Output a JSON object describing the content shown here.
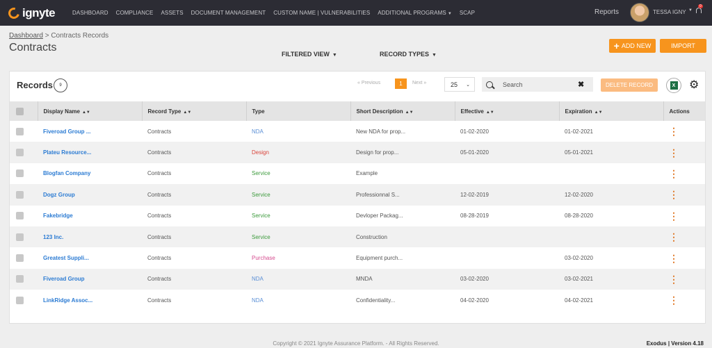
{
  "app": {
    "logo_text": "ignyte"
  },
  "nav": {
    "items": [
      {
        "label": "DASHBOARD",
        "caret": false
      },
      {
        "label": "COMPLIANCE",
        "caret": false
      },
      {
        "label": "ASSETS",
        "caret": false
      },
      {
        "label": "DOCUMENT MANAGEMENT",
        "caret": false
      },
      {
        "label": "CUSTOM NAME | VULNERABILITIES",
        "caret": false
      },
      {
        "label": "ADDITIONAL PROGRAMS",
        "caret": true
      },
      {
        "label": "SCAP",
        "caret": false
      }
    ],
    "reports": "Reports",
    "user_name": "TESSA IGNY",
    "notification_count": "0"
  },
  "header": {
    "breadcrumb": {
      "home": "Dashboard",
      "separator": ">",
      "current": "Contracts Records"
    },
    "title": "Contracts",
    "filtered_view": "FILTERED VIEW",
    "record_types": "RECORD TYPES",
    "add_new": "ADD NEW",
    "import": "IMPORT"
  },
  "records": {
    "title": "Records",
    "count": "9",
    "pagination": {
      "previous": "Previous",
      "current_page": "1",
      "next": "Next"
    },
    "per_page": "25",
    "search_placeholder": "Search",
    "delete_label": "DELETE RECORD",
    "columns": [
      "Display Name",
      "Record Type",
      "Type",
      "Short Description",
      "Effective",
      "Expiration",
      "Actions"
    ],
    "rows": [
      {
        "name": "Fiveroad Group ...",
        "record_type": "Contracts",
        "type": "NDA",
        "type_color": "#5b8fd6",
        "desc": "New NDA for prop...",
        "effective": "01-02-2020",
        "expiration": "01-02-2021"
      },
      {
        "name": "Plateu Resource...",
        "record_type": "Contracts",
        "type": "Design",
        "type_color": "#d9443b",
        "desc": "Design for prop...",
        "effective": "05-01-2020",
        "expiration": "05-01-2021"
      },
      {
        "name": "Blogfan Company",
        "record_type": "Contracts",
        "type": "Service",
        "type_color": "#3c9a3c",
        "desc": "Example",
        "effective": "",
        "expiration": ""
      },
      {
        "name": "Dogz Group",
        "record_type": "Contracts",
        "type": "Service",
        "type_color": "#3c9a3c",
        "desc": "Professionnal S...",
        "effective": "12-02-2019",
        "expiration": "12-02-2020"
      },
      {
        "name": "Fakebridge",
        "record_type": "Contracts",
        "type": "Service",
        "type_color": "#3c9a3c",
        "desc": "Devloper Packag...",
        "effective": "08-28-2019",
        "expiration": "08-28-2020"
      },
      {
        "name": "123 Inc.",
        "record_type": "Contracts",
        "type": "Service",
        "type_color": "#3c9a3c",
        "desc": "Construction",
        "effective": "",
        "expiration": ""
      },
      {
        "name": "Greatest Suppli...",
        "record_type": "Contracts",
        "type": "Purchase",
        "type_color": "#d64c8f",
        "desc": "Equipment purch...",
        "effective": "",
        "expiration": "03-02-2020"
      },
      {
        "name": "Fiveroad Group",
        "record_type": "Contracts",
        "type": "NDA",
        "type_color": "#5b8fd6",
        "desc": "MNDA",
        "effective": "03-02-2020",
        "expiration": "03-02-2021"
      },
      {
        "name": "LinkRidge Assoc...",
        "record_type": "Contracts",
        "type": "NDA",
        "type_color": "#5b8fd6",
        "desc": "Confidentiality...",
        "effective": "04-02-2020",
        "expiration": "04-02-2021"
      }
    ]
  },
  "footer": {
    "copyright": "Copyright © 2021 Ignyte Assurance Platform. - All Rights Reserved.",
    "version": "Exodus | Version 4.18"
  },
  "colors": {
    "accent": "#f7941d",
    "topbar": "#2c2c34",
    "link": "#2b7bd3"
  }
}
